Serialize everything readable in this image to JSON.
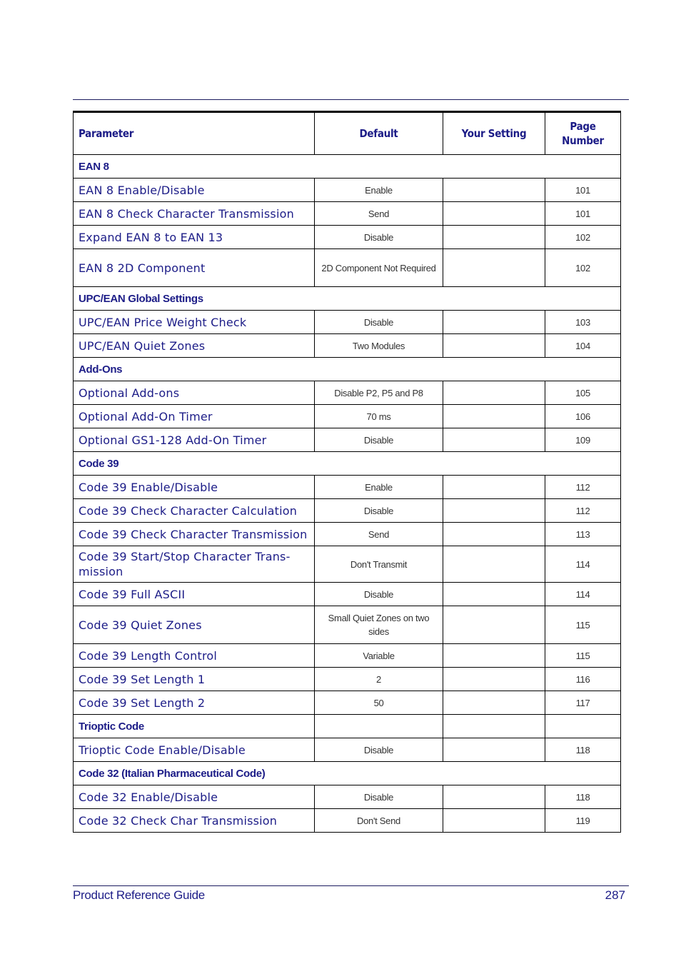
{
  "table": {
    "headers": {
      "parameter": "Parameter",
      "default": "Default",
      "your_setting": "Your Setting",
      "page_number": "Page Number"
    },
    "sections": [
      {
        "title": "EAN 8",
        "rows": [
          {
            "parameter": "EAN 8 Enable/Disable",
            "default": "Enable",
            "your_setting": "",
            "page": "101"
          },
          {
            "parameter": "EAN 8 Check Character Transmission",
            "default": "Send",
            "your_setting": "",
            "page": "101"
          },
          {
            "parameter": "Expand EAN 8 to EAN 13",
            "default": "Disable",
            "your_setting": "",
            "page": "102"
          },
          {
            "parameter": "EAN 8 2D Component",
            "default": "2D Component Not Required",
            "your_setting": "",
            "page": "102"
          }
        ]
      },
      {
        "title": "UPC/EAN Global Settings",
        "rows": [
          {
            "parameter": "UPC/EAN Price Weight Check",
            "default": "Disable",
            "your_setting": "",
            "page": "103"
          },
          {
            "parameter": "UPC/EAN Quiet Zones",
            "default": "Two Modules",
            "your_setting": "",
            "page": "104"
          }
        ]
      },
      {
        "title": "Add-Ons",
        "rows": [
          {
            "parameter": "Optional Add-ons",
            "default": "Disable P2, P5 and P8",
            "your_setting": "",
            "page": "105"
          },
          {
            "parameter": "Optional Add-On Timer",
            "default": "70 ms",
            "your_setting": "",
            "page": "106"
          },
          {
            "parameter": "Optional GS1-128 Add-On Timer",
            "default": "Disable",
            "your_setting": "",
            "page": "109"
          }
        ]
      },
      {
        "title": "Code 39",
        "rows": [
          {
            "parameter": "Code 39 Enable/Disable",
            "default": "Enable",
            "your_setting": "",
            "page": "112"
          },
          {
            "parameter": "Code 39 Check Character Calculation",
            "default": "Disable",
            "your_setting": "",
            "page": "112"
          },
          {
            "parameter": "Code 39 Check Character Transmission",
            "default": "Send",
            "your_setting": "",
            "page": "113"
          },
          {
            "parameter": "Code 39 Start/Stop Character Trans-mission",
            "default": "Don't Transmit",
            "your_setting": "",
            "page": "114"
          },
          {
            "parameter": "Code 39 Full ASCII",
            "default": "Disable",
            "your_setting": "",
            "page": "114"
          },
          {
            "parameter": "Code 39 Quiet Zones",
            "default": "Small Quiet Zones on two sides",
            "your_setting": "",
            "page": "115"
          },
          {
            "parameter": "Code 39 Length Control",
            "default": "Variable",
            "your_setting": "",
            "page": "115"
          },
          {
            "parameter": "Code 39 Set Length 1",
            "default": "2",
            "your_setting": "",
            "page": "116"
          },
          {
            "parameter": "Code 39 Set Length 2",
            "default": "50",
            "your_setting": "",
            "page": "117"
          }
        ]
      },
      {
        "title": "Trioptic Code",
        "rows": [
          {
            "parameter": "Trioptic Code Enable/Disable",
            "default": "Disable",
            "your_setting": "",
            "page": "118"
          }
        ]
      },
      {
        "title": "Code 32 (Italian Pharmaceutical Code)",
        "rows": [
          {
            "parameter": "Code 32 Enable/Disable",
            "default": "Disable",
            "your_setting": "",
            "page": "118"
          },
          {
            "parameter": "Code 32 Check Char Transmission",
            "default": "Don't Send",
            "your_setting": "",
            "page": "119"
          }
        ]
      }
    ]
  },
  "footer": {
    "title": "Product Reference Guide",
    "page_number": "287"
  }
}
